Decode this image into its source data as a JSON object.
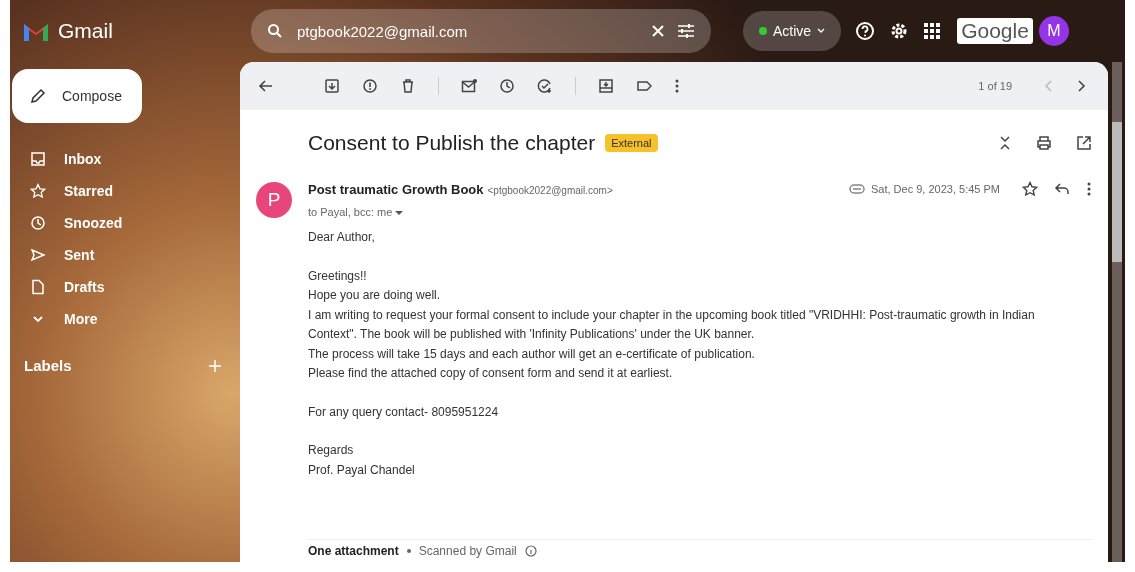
{
  "app": {
    "name": "Gmail"
  },
  "search": {
    "value": "ptgbook2022@gmail.com"
  },
  "status": {
    "label": "Active"
  },
  "account": {
    "brand": "Google",
    "avatar": "M"
  },
  "compose": {
    "label": "Compose"
  },
  "sidebar": {
    "items": [
      {
        "label": "Inbox"
      },
      {
        "label": "Starred"
      },
      {
        "label": "Snoozed"
      },
      {
        "label": "Sent"
      },
      {
        "label": "Drafts"
      },
      {
        "label": "More"
      }
    ],
    "labels_heading": "Labels"
  },
  "toolbar": {
    "pager": "1 of 19"
  },
  "message": {
    "subject": "Consent to Publish the chapter",
    "tag": "External",
    "sender_avatar": "P",
    "sender_name": "Post traumatic Growth Book",
    "sender_email": "<ptgbook2022@gmail.com>",
    "recipients": "to Payal, bcc: me",
    "date": "Sat, Dec 9, 2023, 5:45 PM",
    "body": [
      {
        "lines": [
          "Dear Author,"
        ]
      },
      {
        "lines": [
          "Greetings!!",
          "Hope you are doing well.",
          "I am writing to request your formal consent to include your chapter in the upcoming book titled \"VRIDHHI: Post-traumatic growth in Indian Context\". The book will be published with 'Infinity Publications' under the UK banner.",
          "The process will take 15 days and each author will get an e-certificate of publication.",
          "Please find the attached copy of consent form and send it at earliest."
        ]
      },
      {
        "lines": [
          "For any query contact- 8095951224"
        ]
      },
      {
        "lines": [
          "Regards",
          "Prof. Payal Chandel"
        ]
      }
    ],
    "attachment_heading": "One attachment",
    "scanned": "Scanned by Gmail"
  }
}
